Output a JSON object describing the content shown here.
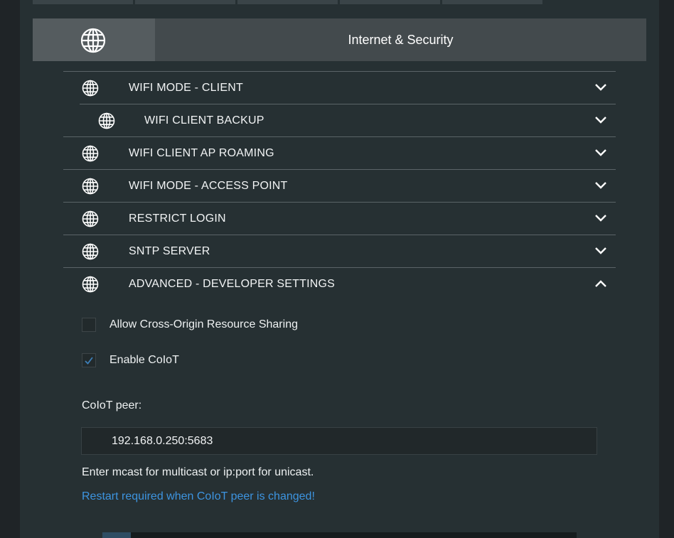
{
  "header": {
    "title": "Internet & Security",
    "icon": "globe-icon"
  },
  "sections": [
    {
      "label": "WIFI MODE - CLIENT",
      "icon": "globe-icon",
      "expanded": false,
      "sub": false
    },
    {
      "label": "WIFI CLIENT BACKUP",
      "icon": "globe-icon",
      "expanded": false,
      "sub": true
    },
    {
      "label": "WIFI CLIENT AP ROAMING",
      "icon": "globe-icon",
      "expanded": false,
      "sub": false
    },
    {
      "label": "WIFI MODE - ACCESS POINT",
      "icon": "globe-icon",
      "expanded": false,
      "sub": false
    },
    {
      "label": "RESTRICT LOGIN",
      "icon": "globe-icon",
      "expanded": false,
      "sub": false
    },
    {
      "label": "SNTP SERVER",
      "icon": "globe-icon",
      "expanded": false,
      "sub": false
    },
    {
      "label": "ADVANCED - DEVELOPER SETTINGS",
      "icon": "globe-icon",
      "expanded": true,
      "sub": false
    }
  ],
  "advanced": {
    "cors_label": "Allow Cross-Origin Resource Sharing",
    "cors_checked": false,
    "coiot_label": "Enable CoIoT",
    "coiot_checked": true,
    "peer_label": "CoIoT peer:",
    "peer_value": "192.168.0.250:5683",
    "hint": "Enter mcast for multicast or ip:port for unicast.",
    "warning": "Restart required when CoIoT peer is changed!"
  },
  "colors": {
    "accent": "#3d94e0",
    "background": "#263033",
    "header": "#434a4d"
  }
}
